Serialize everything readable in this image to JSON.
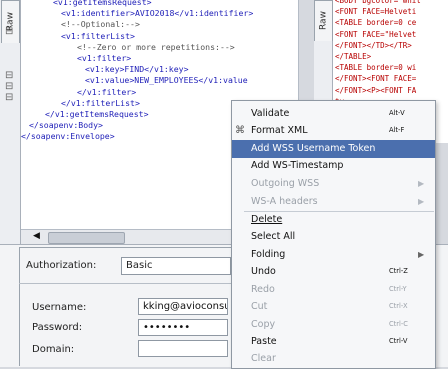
{
  "left_editor": {
    "tab_label": "Raw",
    "lines": [
      {
        "indent": 4,
        "text": "<v1:getItemsRequest>",
        "kind": "tag"
      },
      {
        "indent": 5,
        "text": "<v1:identifier>AVIO2018</v1:identifier>",
        "kind": "tag"
      },
      {
        "indent": 5,
        "text": "<!--Optional:-->",
        "kind": "comment"
      },
      {
        "indent": 5,
        "text": "<v1:filterList>",
        "kind": "tag"
      },
      {
        "indent": 7,
        "text": "<!--Zero or more repetitions:-->",
        "kind": "comment"
      },
      {
        "indent": 7,
        "text": "<v1:filter>",
        "kind": "tag"
      },
      {
        "indent": 8,
        "text": "<v1:key>FIND</v1:key>",
        "kind": "tag"
      },
      {
        "indent": 8,
        "text": "<v1:value>NEW_EMPLOYEES</v1:value",
        "kind": "tag"
      },
      {
        "indent": 7,
        "text": "</v1:filter>",
        "kind": "tag"
      },
      {
        "indent": 5,
        "text": "</v1:filterList>",
        "kind": "tag"
      },
      {
        "indent": 3,
        "text": "</v1:getItemsRequest>",
        "kind": "tag"
      },
      {
        "indent": 1,
        "text": "</soapenv:Body>",
        "kind": "tag"
      },
      {
        "indent": 0,
        "text": "</soapenv:Envelope>",
        "kind": "tag"
      }
    ],
    "gutter_marks": [
      "⊟",
      "⊟",
      "⊟",
      "⊟"
    ]
  },
  "right_editor": {
    "tab_label": "Raw",
    "lines": [
      "<BODY bgcolor=\"whit",
      "<FONT FACE=Helveti",
      "<TABLE border=0 ce",
      "<FONT FACE=\"Helvet",
      "</FONT></TD></TR>",
      "</TABLE>",
      "<TABLE border=0 wi",
      "</FONT><FONT FACE=",
      "</FONT><P><FONT FA",
      "ty",
      "",
      "",
      "R>"
    ]
  },
  "bottom_panel": {
    "authorization_label": "Authorization:",
    "authorization_value": "Basic",
    "username_label": "Username:",
    "username_value": "kking@avioconsul",
    "password_label": "Password:",
    "password_value": "••••••••",
    "domain_label": "Domain:",
    "domain_value": ""
  },
  "context_menu": {
    "items": [
      {
        "label": "Validate",
        "shortcut": "Alt-V",
        "disabled": false,
        "selected": false,
        "icon": ""
      },
      {
        "label": "Format XML",
        "shortcut": "Alt-F",
        "disabled": false,
        "selected": false,
        "icon": "format-icon"
      },
      {
        "label": "Add WSS Username Token",
        "shortcut": "",
        "disabled": false,
        "selected": true,
        "icon": ""
      },
      {
        "label": "Add WS-Timestamp",
        "shortcut": "",
        "disabled": false,
        "selected": false,
        "icon": ""
      },
      {
        "label": "Outgoing WSS",
        "shortcut": "",
        "disabled": true,
        "selected": false,
        "icon": ""
      },
      {
        "label": "WS-A headers",
        "shortcut": "",
        "disabled": true,
        "selected": false,
        "icon": ""
      },
      {
        "label": "Delete",
        "shortcut": "",
        "disabled": false,
        "selected": false,
        "icon": ""
      },
      {
        "label": "Select All",
        "shortcut": "",
        "disabled": false,
        "selected": false,
        "icon": ""
      },
      {
        "label": "Folding",
        "shortcut": "",
        "disabled": false,
        "selected": false,
        "icon": ""
      },
      {
        "label": "Undo",
        "shortcut": "Ctrl-Z",
        "disabled": false,
        "selected": false,
        "icon": ""
      },
      {
        "label": "Redo",
        "shortcut": "Ctrl-Y",
        "disabled": true,
        "selected": false,
        "icon": ""
      },
      {
        "label": "Cut",
        "shortcut": "Ctrl-X",
        "disabled": true,
        "selected": false,
        "icon": ""
      },
      {
        "label": "Copy",
        "shortcut": "Ctrl-C",
        "disabled": true,
        "selected": false,
        "icon": ""
      },
      {
        "label": "Paste",
        "shortcut": "Ctrl-V",
        "disabled": false,
        "selected": false,
        "icon": ""
      },
      {
        "label": "Clear",
        "shortcut": "",
        "disabled": true,
        "selected": false,
        "icon": ""
      }
    ]
  }
}
